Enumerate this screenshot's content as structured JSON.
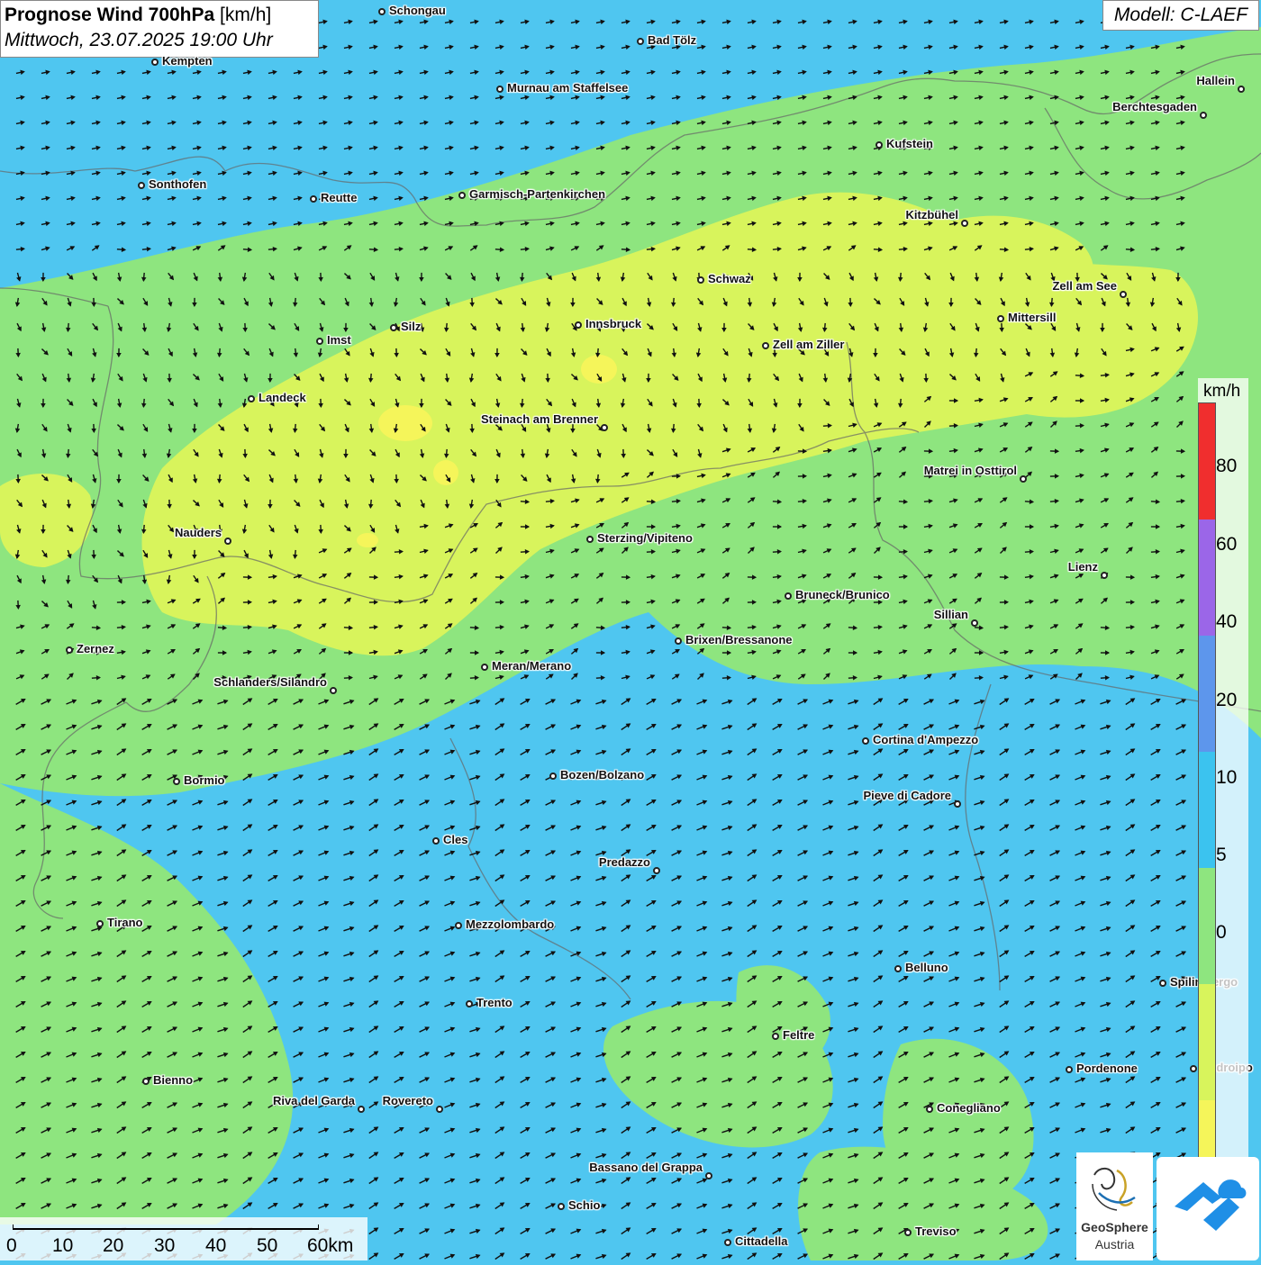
{
  "header": {
    "title_bold": "Prognose Wind 700hPa",
    "title_unit": "[km/h]",
    "subtitle": "Mittwoch, 23.07.2025 19:00 Uhr",
    "model": "Modell: C-LAEF"
  },
  "legend": {
    "unit": "km/h",
    "ticks": [
      "80",
      "60",
      "40",
      "20",
      "10",
      "5",
      "0"
    ],
    "colors": [
      "#f02e2e",
      "#9b66e8",
      "#5d96ec",
      "#3bc3ef",
      "#8ee57f",
      "#d8f45c",
      "#f5f55a"
    ]
  },
  "scale_bar": {
    "labels": [
      "0",
      "10",
      "20",
      "30",
      "40",
      "50",
      "60km"
    ]
  },
  "logos": {
    "geosphere_line1": "GeoSphere",
    "geosphere_line2": "Austria"
  },
  "cities": [
    {
      "name": "Schongau"
    },
    {
      "name": "Bad Tölz"
    },
    {
      "name": "Kempten"
    },
    {
      "name": "Murnau am Staffelsee"
    },
    {
      "name": "Hallein"
    },
    {
      "name": "Berchtesgaden"
    },
    {
      "name": "Kufstein"
    },
    {
      "name": "Sonthofen"
    },
    {
      "name": "Reutte"
    },
    {
      "name": "Garmisch-Partenkirchen"
    },
    {
      "name": "Kitzbühel"
    },
    {
      "name": "Schwaz"
    },
    {
      "name": "Zell am See"
    },
    {
      "name": "Mittersill"
    },
    {
      "name": "Innsbruck"
    },
    {
      "name": "Silz"
    },
    {
      "name": "Imst"
    },
    {
      "name": "Zell am Ziller"
    },
    {
      "name": "Landeck"
    },
    {
      "name": "Steinach am Brenner"
    },
    {
      "name": "Matrei in Osttirol"
    },
    {
      "name": "Nauders"
    },
    {
      "name": "Sterzing/Vipiteno"
    },
    {
      "name": "Lienz"
    },
    {
      "name": "Bruneck/Brunico"
    },
    {
      "name": "Sillian"
    },
    {
      "name": "Brixen/Bressanone"
    },
    {
      "name": "Zernez"
    },
    {
      "name": "Meran/Merano"
    },
    {
      "name": "Schlanders/Silandro"
    },
    {
      "name": "Cortina d'Ampezzo"
    },
    {
      "name": "Bozen/Bolzano"
    },
    {
      "name": "Bormio"
    },
    {
      "name": "Pieve di Cadore"
    },
    {
      "name": "Cles"
    },
    {
      "name": "Predazzo"
    },
    {
      "name": "Tirano"
    },
    {
      "name": "Mezzolombardo"
    },
    {
      "name": "Belluno"
    },
    {
      "name": "Spilimbergo"
    },
    {
      "name": "Trento"
    },
    {
      "name": "Feltre"
    },
    {
      "name": "Pordenone"
    },
    {
      "name": "Codroipo"
    },
    {
      "name": "Bienno"
    },
    {
      "name": "Riva del Garda"
    },
    {
      "name": "Rovereto"
    },
    {
      "name": "Conegliano"
    },
    {
      "name": "Bassano del Grappa"
    },
    {
      "name": "Schio"
    },
    {
      "name": "Treviso"
    },
    {
      "name": "Cittadella"
    }
  ]
}
